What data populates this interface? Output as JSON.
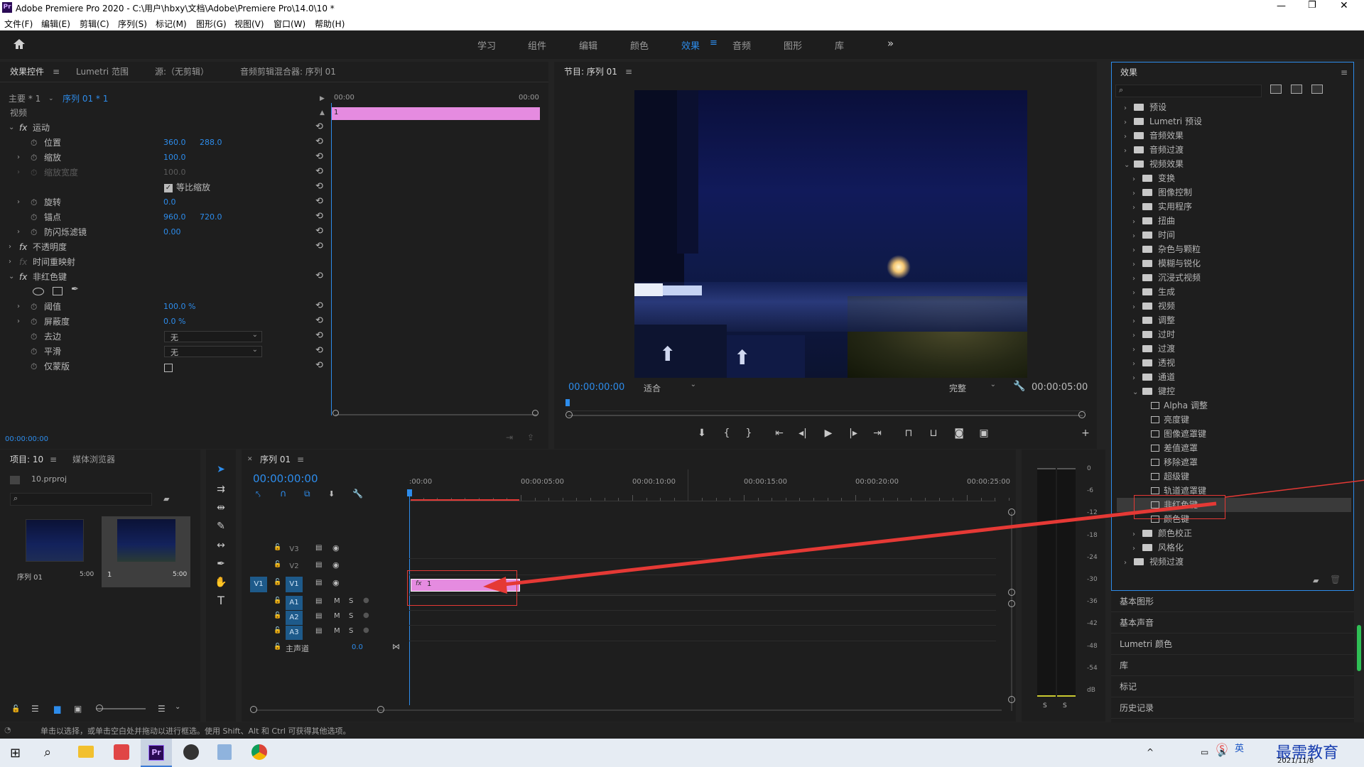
{
  "app": {
    "title": "Adobe Premiere Pro 2020 - C:\\用户\\hbxy\\文档\\Adobe\\Premiere Pro\\14.0\\10 *",
    "logo": "Pr"
  },
  "menu": [
    "文件(F)",
    "编辑(E)",
    "剪辑(C)",
    "序列(S)",
    "标记(M)",
    "图形(G)",
    "视图(V)",
    "窗口(W)",
    "帮助(H)"
  ],
  "workspaces": [
    "学习",
    "组件",
    "编辑",
    "颜色",
    "效果",
    "音频",
    "图形",
    "库"
  ],
  "ws_active": "效果",
  "effect_controls": {
    "tabs": [
      "效果控件",
      "Lumetri 范围",
      "源:（无剪辑）",
      "音频剪辑混合器: 序列 01"
    ],
    "master": "主要 * 1",
    "seq": "序列 01 * 1",
    "video": "视频",
    "ruler_start": "00:00",
    "ruler_end": "00:00",
    "clip": "1",
    "motion": "运动",
    "position_label": "位置",
    "position_x": "360.0",
    "position_y": "288.0",
    "scale_label": "缩放",
    "scale_val": "100.0",
    "scale_w_label": "缩放宽度",
    "scale_w_val": "100.0",
    "uniform": "等比缩放",
    "rotation_label": "旋转",
    "rotation_val": "0.0",
    "anchor_label": "锚点",
    "anchor_x": "960.0",
    "anchor_y": "720.0",
    "flicker_label": "防闪烁滤镜",
    "flicker_val": "0.00",
    "opacity": "不透明度",
    "remap": "时间重映射",
    "nonred": "非红色键",
    "threshold_label": "阈值",
    "threshold_val": "100.0 %",
    "cutoff_label": "屏蔽度",
    "cutoff_val": "0.0 %",
    "defringe_label": "去边",
    "defringe_val": "无",
    "smooth_label": "平滑",
    "smooth_val": "无",
    "mask_only_label": "仅蒙版",
    "timecode": "00:00:00:00"
  },
  "program": {
    "title": "节目: 序列 01",
    "timecode": "00:00:00:00",
    "fit": "适合",
    "quality": "完整",
    "duration": "00:00:05:00"
  },
  "project": {
    "tabs": [
      "项目: 10",
      "媒体浏览器"
    ],
    "file": "10.prproj",
    "items": [
      {
        "name": "序列 01",
        "dur": "5:00"
      },
      {
        "name": "1",
        "dur": "5:00"
      }
    ]
  },
  "timeline": {
    "tab": "序列 01",
    "timecode": "00:00:00:00",
    "ticks": [
      ":00:00",
      "00:00:05:00",
      "00:00:10:00",
      "00:00:15:00",
      "00:00:20:00",
      "00:00:25:00"
    ],
    "tracks_v": [
      "V3",
      "V2",
      "V1"
    ],
    "tracks_a": [
      "A1",
      "A2",
      "A3"
    ],
    "src_v": "V1",
    "master": "主声道",
    "master_val": "0.0",
    "clip": "1",
    "m": "M",
    "s": "S"
  },
  "meter": {
    "scale": [
      "0",
      "-6",
      "-12",
      "-18",
      "-24",
      "-30",
      "-36",
      "-42",
      "-48",
      "-54",
      "dB"
    ],
    "solo": [
      "S",
      "S"
    ]
  },
  "effects": {
    "title": "效果",
    "tree": [
      {
        "t": "预设",
        "lvl": 0,
        "k": "folder",
        "open": false
      },
      {
        "t": "Lumetri 预设",
        "lvl": 0,
        "k": "folder",
        "open": false
      },
      {
        "t": "音频效果",
        "lvl": 0,
        "k": "folder",
        "open": false
      },
      {
        "t": "音频过渡",
        "lvl": 0,
        "k": "folder",
        "open": false
      },
      {
        "t": "视频效果",
        "lvl": 0,
        "k": "folder",
        "open": true
      },
      {
        "t": "变换",
        "lvl": 1,
        "k": "folder",
        "open": false
      },
      {
        "t": "图像控制",
        "lvl": 1,
        "k": "folder",
        "open": false
      },
      {
        "t": "实用程序",
        "lvl": 1,
        "k": "folder",
        "open": false
      },
      {
        "t": "扭曲",
        "lvl": 1,
        "k": "folder",
        "open": false
      },
      {
        "t": "时间",
        "lvl": 1,
        "k": "folder",
        "open": false
      },
      {
        "t": "杂色与颗粒",
        "lvl": 1,
        "k": "folder",
        "open": false
      },
      {
        "t": "模糊与锐化",
        "lvl": 1,
        "k": "folder",
        "open": false
      },
      {
        "t": "沉浸式视频",
        "lvl": 1,
        "k": "folder",
        "open": false
      },
      {
        "t": "生成",
        "lvl": 1,
        "k": "folder",
        "open": false
      },
      {
        "t": "视频",
        "lvl": 1,
        "k": "folder",
        "open": false
      },
      {
        "t": "调整",
        "lvl": 1,
        "k": "folder",
        "open": false
      },
      {
        "t": "过时",
        "lvl": 1,
        "k": "folder",
        "open": false
      },
      {
        "t": "过渡",
        "lvl": 1,
        "k": "folder",
        "open": false
      },
      {
        "t": "透视",
        "lvl": 1,
        "k": "folder",
        "open": false
      },
      {
        "t": "通道",
        "lvl": 1,
        "k": "folder",
        "open": false
      },
      {
        "t": "键控",
        "lvl": 1,
        "k": "folder",
        "open": true
      },
      {
        "t": "Alpha 调整",
        "lvl": 2,
        "k": "fx"
      },
      {
        "t": "亮度键",
        "lvl": 2,
        "k": "fx"
      },
      {
        "t": "图像遮罩键",
        "lvl": 2,
        "k": "fx"
      },
      {
        "t": "差值遮罩",
        "lvl": 2,
        "k": "fx"
      },
      {
        "t": "移除遮罩",
        "lvl": 2,
        "k": "fx"
      },
      {
        "t": "超级键",
        "lvl": 2,
        "k": "fx"
      },
      {
        "t": "轨道遮罩键",
        "lvl": 2,
        "k": "fx"
      },
      {
        "t": "非红色键",
        "lvl": 2,
        "k": "fx",
        "selected": true
      },
      {
        "t": "颜色键",
        "lvl": 2,
        "k": "fx"
      },
      {
        "t": "颜色校正",
        "lvl": 1,
        "k": "folder",
        "open": false
      },
      {
        "t": "风格化",
        "lvl": 1,
        "k": "folder",
        "open": false
      },
      {
        "t": "视频过渡",
        "lvl": 0,
        "k": "folder",
        "open": false
      }
    ],
    "collapsed": [
      "基本图形",
      "基本声音",
      "Lumetri 颜色",
      "库",
      "标记",
      "历史记录"
    ]
  },
  "status": "单击以选择，或单击空白处并拖动以进行框选。使用 Shift、Alt 和 Ctrl 可获得其他选项。",
  "taskbar": {
    "ime": "英",
    "watermark": "最需教育",
    "date": "2021/11/8"
  },
  "colors": {
    "accent": "#2d8ceb",
    "clip": "#e58be0",
    "highlight": "#e53935"
  }
}
